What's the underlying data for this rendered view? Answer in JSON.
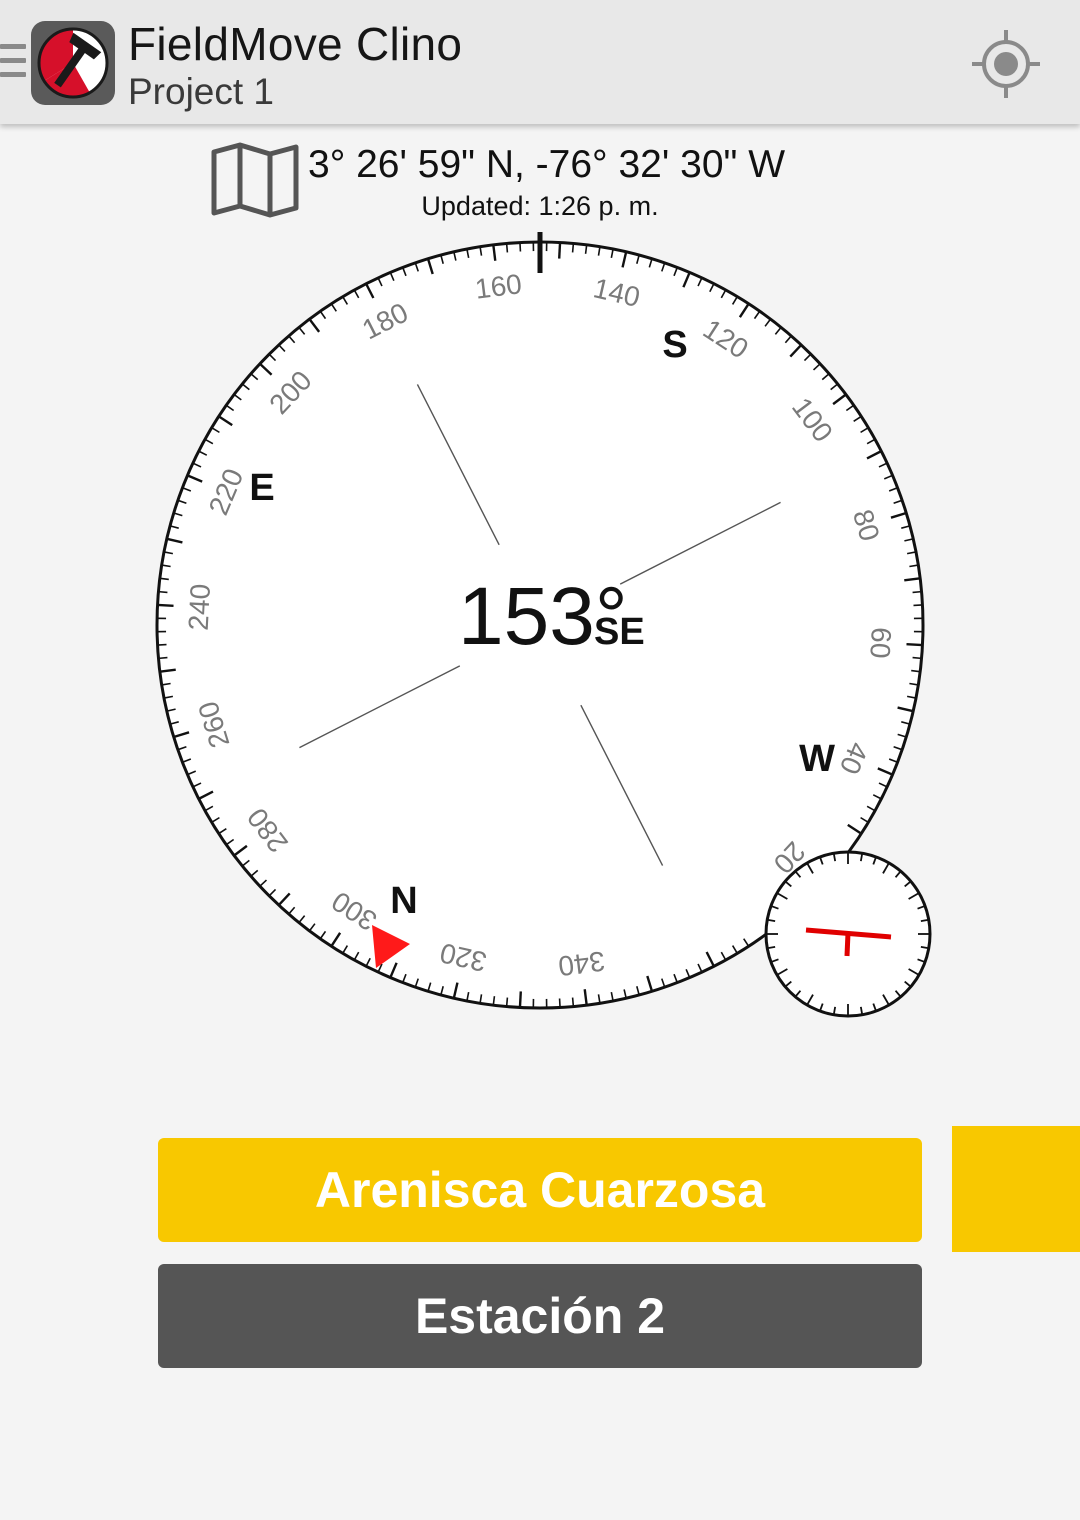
{
  "app": {
    "title": "FieldMove Clino",
    "subtitle": "Project 1"
  },
  "icons": {
    "menu": "hamburger-icon",
    "logo": "fieldmove-hammer-logo",
    "locate": "crosshair-location-icon",
    "map": "folded-map-icon"
  },
  "location": {
    "coordinates": "3° 26' 59\" N, -76° 32' 30\" W",
    "updated": "Updated: 1:26 p. m."
  },
  "compass": {
    "heading_value": "153°",
    "heading_dir": "SE",
    "heading_degrees": 153,
    "cardinals": {
      "N": "N",
      "E": "E",
      "S": "S",
      "W": "W"
    },
    "numbers": [
      "20",
      "40",
      "60",
      "80",
      "100",
      "120",
      "140",
      "160",
      "180",
      "200",
      "220",
      "240",
      "260",
      "280",
      "300",
      "320",
      "340"
    ],
    "north_marker_color": "#ff1a1a"
  },
  "inclinometer": {
    "symbol_color": "#e00000",
    "icon": "strike-dip-symbol"
  },
  "buttons": {
    "rock_label": "Arenisca Cuarzosa",
    "station_label": "Estación 2"
  },
  "colors": {
    "rock_button": "#f8c800",
    "station_button": "#555555"
  }
}
